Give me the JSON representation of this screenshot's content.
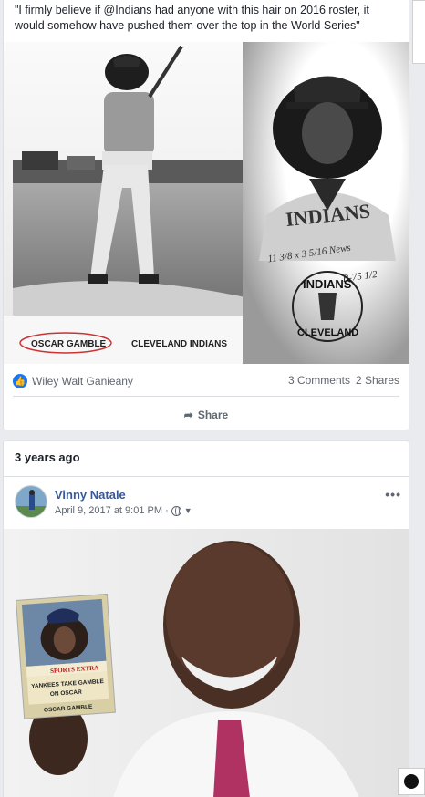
{
  "post1": {
    "text": "\"I firmly believe if @Indians had anyone with this hair on 2016 roster, it would somehow have pushed them over the top in the World Series\"",
    "photo": {
      "left_caption": "OSCAR GAMBLE",
      "right_caption": "CLEVELAND INDIANS",
      "handwriting_line1": "11 3/8 x 3 5/16 News",
      "handwriting_line2": "B-75 1/2",
      "logo_top": "INDIANS",
      "logo_bottom": "CLEVELAND",
      "jersey_text": "INDIANS"
    },
    "reactions": {
      "icon": "like-icon",
      "names": "Wiley Walt Ganieany"
    },
    "counts": {
      "comments": "3 Comments",
      "shares": "2 Shares"
    },
    "share_label": "Share"
  },
  "post2": {
    "time_header": "3 years ago",
    "author": "Vinny Natale",
    "timestamp": "April 9, 2017 at 9:01 PM ·",
    "more": "•••",
    "photo": {
      "card_banner": "SPORTS EXTRA",
      "card_headline_1": "YANKEES TAKE GAMBLE",
      "card_headline_2": "ON OSCAR",
      "card_name": "OSCAR GAMBLE"
    }
  },
  "colors": {
    "link": "#385898",
    "like": "#1877f2",
    "background": "#e9ebee"
  }
}
